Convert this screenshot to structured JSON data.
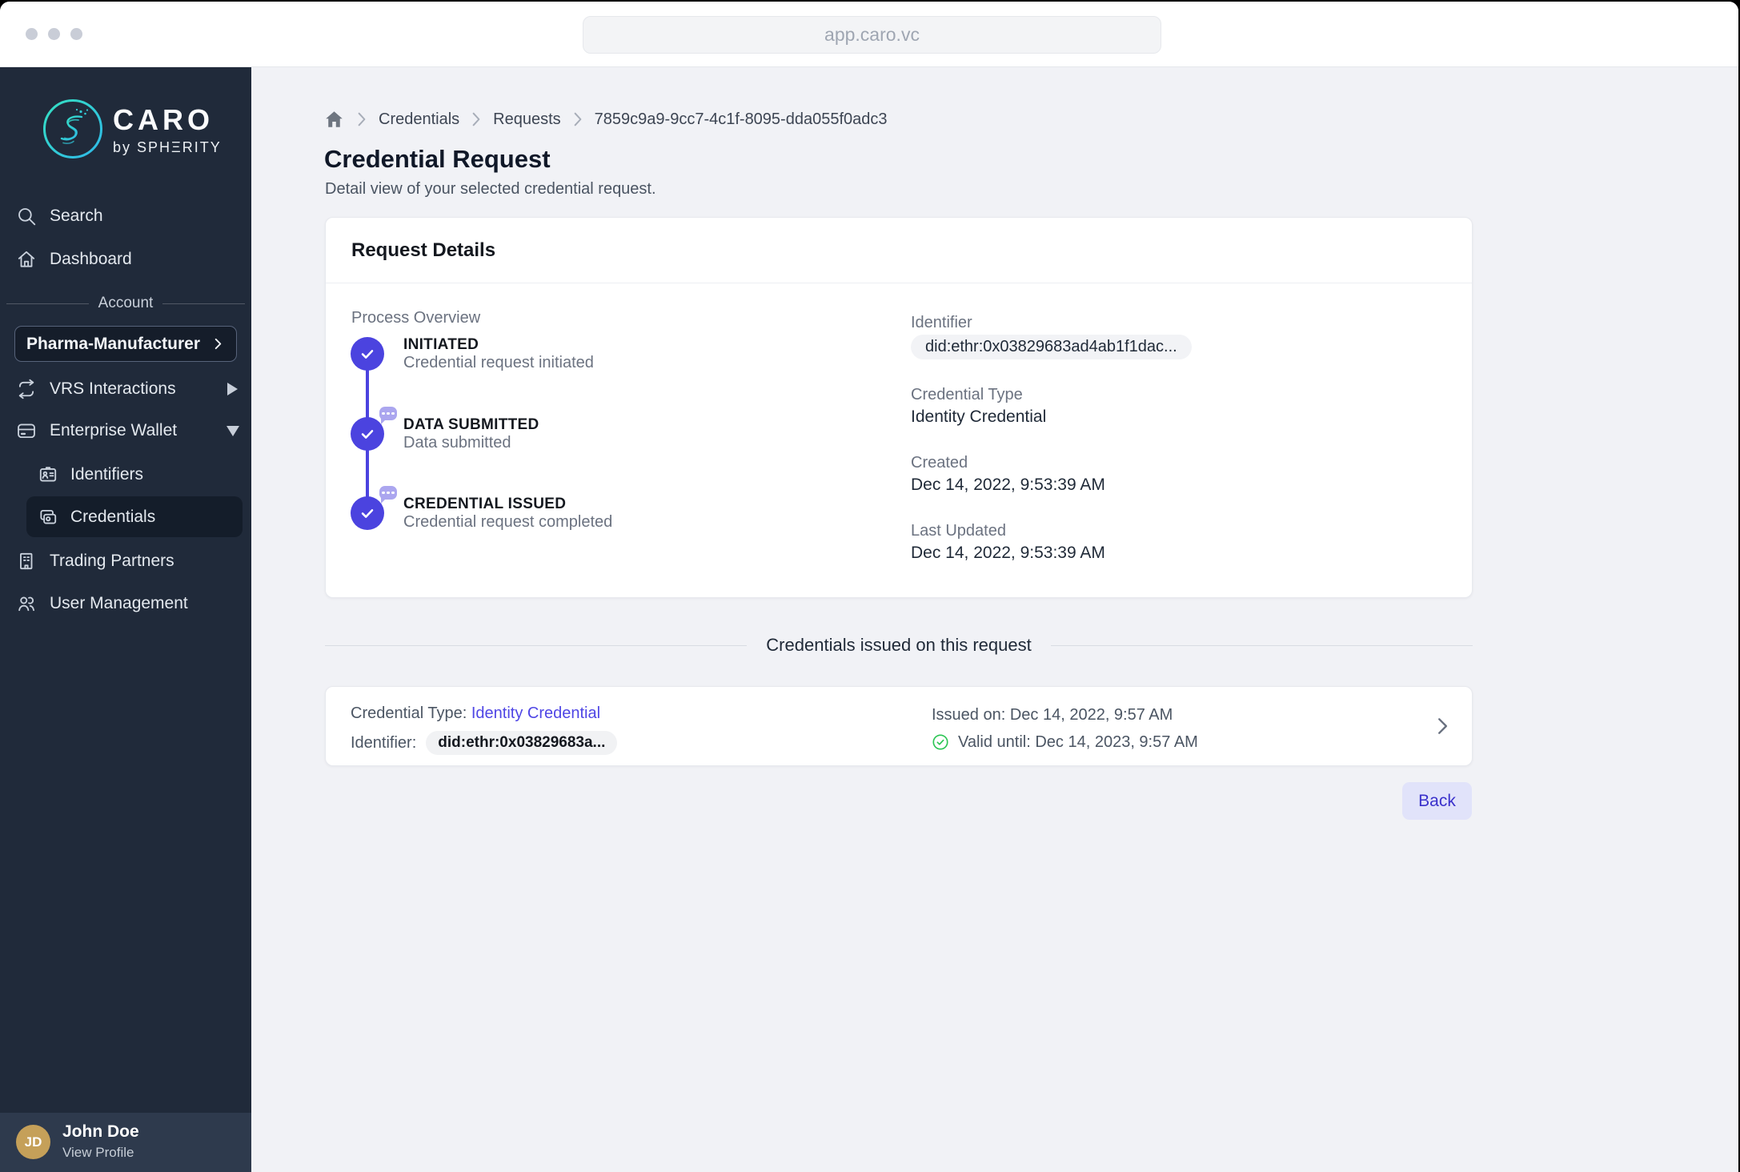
{
  "window": {
    "url": "app.caro.vc"
  },
  "colors": {
    "accent": "#4B43DF",
    "accent_light": "#E1E3FA",
    "link": "#4F46E5",
    "success": "#2BC553",
    "sidebar_bg": "#202A3A",
    "sidebar_selected_bg": "#141D2A",
    "avatar_gold": "#C5A059",
    "content_bg": "#F1F2F6"
  },
  "icons": {
    "window_controls": "three-gray-dots",
    "logo": "caro-s-gradient-circle",
    "search": "magnifier",
    "dashboard": "home",
    "vrs_interactions": "swap-arrows",
    "enterprise_wallet": "credit-card",
    "identifiers": "id-badge",
    "credentials": "stacked-cards",
    "trading_partners": "building",
    "user_management": "two-users",
    "breadcrumb_home": "house-filled",
    "step_done": "check-circle",
    "comment": "chat-bubble-dots",
    "valid": "green-check-circle",
    "open_item": "chevron-right"
  },
  "sidebar": {
    "logo": {
      "title": "CARO",
      "byline": "by SPHΞRITY"
    },
    "nav": {
      "search": "Search",
      "dashboard": "Dashboard",
      "account_label": "Account",
      "account_button": "Pharma-Manufacturer",
      "vrs": "VRS Interactions",
      "wallet": "Enterprise Wallet",
      "identifiers": "Identifiers",
      "credentials": "Credentials",
      "trading_partners": "Trading Partners",
      "user_management": "User Management"
    },
    "profile": {
      "initials": "JD",
      "name": "John Doe",
      "action": "View Profile"
    }
  },
  "breadcrumb": {
    "items": [
      "Credentials",
      "Requests",
      "7859c9a9-9cc7-4c1f-8095-dda055f0adc3"
    ]
  },
  "page": {
    "title": "Credential Request",
    "subtitle": "Detail view of your selected credential request."
  },
  "request_details": {
    "header": "Request Details",
    "process_label": "Process Overview",
    "steps": [
      {
        "title": "INITIATED",
        "description": "Credential request initiated"
      },
      {
        "title": "DATA SUBMITTED",
        "description": "Data submitted"
      },
      {
        "title": "CREDENTIAL ISSUED",
        "description": "Credential request completed"
      }
    ],
    "fields": [
      {
        "label": "Identifier",
        "value": "did:ethr:0x03829683ad4ab1f1dac..."
      },
      {
        "label": "Credential Type",
        "value": "Identity Credential"
      },
      {
        "label": "Created",
        "value": "Dec 14, 2022, 9:53:39 AM"
      },
      {
        "label": "Last Updated",
        "value": "Dec 14, 2022, 9:53:39 AM"
      }
    ]
  },
  "issued": {
    "divider_title": "Credentials issued on this request",
    "type_label": "Credential Type:",
    "type_value": "Identity Credential",
    "identifier_label": "Identifier:",
    "identifier_chip": "did:ethr:0x03829683a...",
    "issued_on": "Issued on: Dec 14, 2022, 9:57 AM",
    "valid_until": "Valid until: Dec 14, 2023, 9:57 AM"
  },
  "actions": {
    "back": "Back"
  }
}
